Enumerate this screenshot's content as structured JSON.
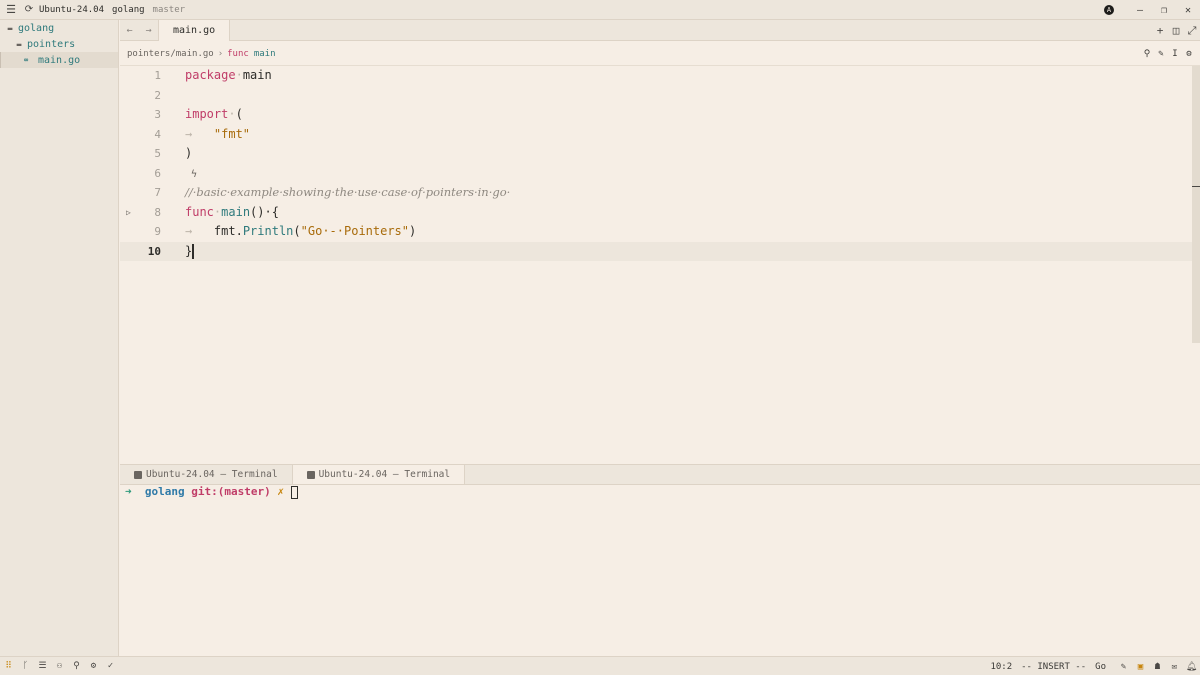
{
  "titlebar": {
    "title": "Ubuntu-24.04",
    "project": "golang",
    "branch": "master",
    "avatar": "A"
  },
  "sidebar": {
    "items": [
      {
        "label": "golang"
      },
      {
        "label": "pointers"
      },
      {
        "label": "main.go"
      }
    ]
  },
  "tabs": [
    {
      "label": "main.go"
    }
  ],
  "breadcrumb": {
    "path": "pointers/main.go",
    "separator": "›",
    "keyword": "func",
    "symbol": "main"
  },
  "editor": {
    "active_line": 10,
    "lines": [
      {
        "num": "1"
      },
      {
        "num": "2"
      },
      {
        "num": "3"
      },
      {
        "num": "4"
      },
      {
        "num": "5"
      },
      {
        "num": "6"
      },
      {
        "num": "7"
      },
      {
        "num": "8"
      },
      {
        "num": "9"
      },
      {
        "num": "10"
      }
    ],
    "tokens": {
      "package_kw": "package",
      "package_name": "main",
      "import_kw": "import",
      "import_open": "(",
      "fmt_str": "\"fmt\"",
      "import_close": ")",
      "comment": "//·basic·example·showing·the·use·case·of·pointers·in·go·",
      "func_kw": "func",
      "func_name": "main",
      "func_sig": "()·{",
      "pkg": "fmt",
      "call": "Println",
      "arg": "\"Go·-·Pointers\"",
      "close_brace": "}"
    }
  },
  "panel": {
    "tabs": [
      {
        "label": "Ubuntu-24.04 — Terminal"
      },
      {
        "label": "Ubuntu-24.04 — Terminal"
      }
    ]
  },
  "terminal": {
    "arrow": "➜",
    "dir": "golang",
    "git_label": "git:(",
    "branch": "master",
    "git_close": ")",
    "dirty": "✗"
  },
  "statusbar": {
    "cursor_pos": "10:2",
    "mode": "-- INSERT --",
    "language": "Go"
  }
}
